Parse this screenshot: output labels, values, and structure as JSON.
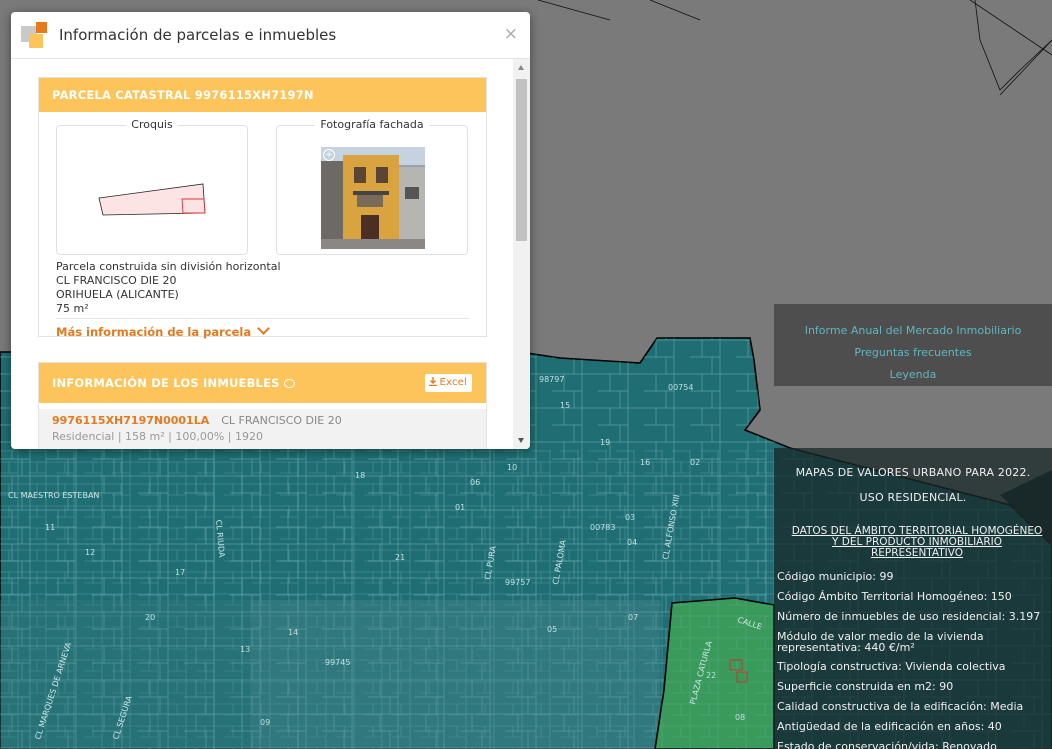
{
  "dialog": {
    "title": "Información de parcelas e inmuebles",
    "close_glyph": "×",
    "app_icon": "layers-icon"
  },
  "parcel": {
    "band_title": "PARCELA CATASTRAL 9976115XH7197N",
    "croquis_label": "Croquis",
    "photo_label": "Fotografía fachada",
    "zoom_glyph": "+",
    "type": "Parcela construida sin división horizontal",
    "street": "CL FRANCISCO DIE 20",
    "city": "ORIHUELA (ALICANTE)",
    "area": "75 m²",
    "more_link": "Más información de la parcela"
  },
  "units": {
    "band_title": "INFORMACIÓN DE LOS INMUEBLES",
    "excel_label": "Excel",
    "items": [
      {
        "ref": "9976115XH7197N0001LA",
        "address": "CL FRANCISCO DIE 20",
        "meta": "Residencial | 158 m² | 100,00% | 1920"
      }
    ]
  },
  "links_panel": {
    "items": [
      "Informe Anual del Mercado Inmobiliario",
      "Preguntas frecuentes",
      "Leyenda"
    ]
  },
  "info_panel": {
    "title_line1": "MAPAS DE VALORES URBANO PARA 2022.",
    "title_line2": "USO RESIDENCIAL.",
    "subtitle": "DATOS DEL ÁMBITO TERRITORIAL HOMOGÉNEO\nY DEL PRODUCTO INMOBILIARIO\nREPRESENTATIVO",
    "rows": [
      "Código municipio: 99",
      "Código Ámbito Territorial Homogéneo: 150",
      "Número de inmuebles de uso residencial: 3.197",
      "Módulo de valor medio de la vivienda\nrepresentativa: 440 €/m²",
      "Tipología constructiva: Vivienda colectiva",
      "Superficie construida en m2: 90",
      "Calidad constructiva de la edificación: Media",
      "Antigüedad de la edificación en años: 40",
      "Estado de conservación/vida: Renovado"
    ]
  },
  "map": {
    "street_labels": [
      "CL MAESTRO ESTEBAN",
      "CL MARQUES DE ARNEVA",
      "CL SEGURA",
      "PLAZA CATURLA",
      "CALLE",
      "CL RIUDA",
      "CL ALFONSO XIII",
      "CL PURA",
      "CL PALOMA"
    ],
    "block_labels": [
      "00754",
      "99745",
      "98797",
      "99757",
      "00783",
      "01",
      "02",
      "03",
      "04",
      "05",
      "06",
      "07",
      "08",
      "09",
      "10",
      "11",
      "12",
      "13",
      "14",
      "15",
      "16",
      "17",
      "18",
      "19",
      "20",
      "21",
      "22"
    ],
    "colors": {
      "background": "#7a7a7a",
      "zone_teal": "#1f6e73",
      "zone_green": "#3a9a5c",
      "outline": "#000000",
      "accent_orange": "#e6791c",
      "band_yellow": "#fcc45a"
    }
  }
}
